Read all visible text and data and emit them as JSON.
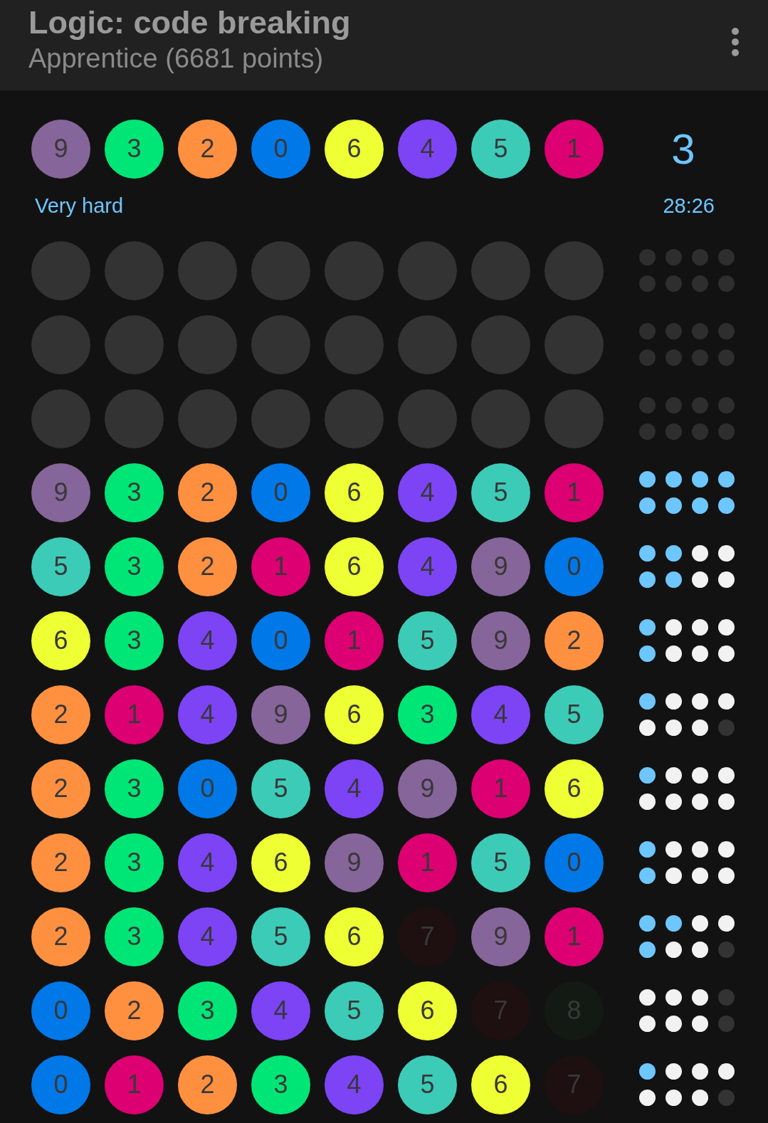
{
  "app_bar": {
    "title": "Logic: code breaking",
    "subtitle": "Apprentice (6681 points)"
  },
  "secret": {
    "pegs": [
      {
        "digit": "9",
        "color": "#86659a"
      },
      {
        "digit": "3",
        "color": "#00e676"
      },
      {
        "digit": "2",
        "color": "#ff9040"
      },
      {
        "digit": "0",
        "color": "#0078e8"
      },
      {
        "digit": "6",
        "color": "#eeff33"
      },
      {
        "digit": "4",
        "color": "#7c44f5"
      },
      {
        "digit": "5",
        "color": "#3ccbb7"
      },
      {
        "digit": "1",
        "color": "#dc0073"
      }
    ],
    "count": "3",
    "difficulty": "Very hard",
    "time": "28:26"
  },
  "rows": [
    {
      "kind": "empty"
    },
    {
      "kind": "empty"
    },
    {
      "kind": "empty"
    },
    {
      "kind": "guess",
      "pegs": [
        {
          "digit": "9",
          "color": "#86659a"
        },
        {
          "digit": "3",
          "color": "#00e676"
        },
        {
          "digit": "2",
          "color": "#ff9040"
        },
        {
          "digit": "0",
          "color": "#0078e8"
        },
        {
          "digit": "6",
          "color": "#eeff33"
        },
        {
          "digit": "4",
          "color": "#7c44f5"
        },
        {
          "digit": "5",
          "color": "#3ccbb7"
        },
        {
          "digit": "1",
          "color": "#dc0073"
        }
      ],
      "feedback": [
        {
          "kind": "hit"
        },
        {
          "kind": "hit"
        },
        {
          "kind": "hit"
        },
        {
          "kind": "hit"
        },
        {
          "kind": "hit"
        },
        {
          "kind": "hit"
        },
        {
          "kind": "hit"
        },
        {
          "kind": "hit"
        }
      ]
    },
    {
      "kind": "guess",
      "pegs": [
        {
          "digit": "5",
          "color": "#3ccbb7"
        },
        {
          "digit": "3",
          "color": "#00e676"
        },
        {
          "digit": "2",
          "color": "#ff9040"
        },
        {
          "digit": "1",
          "color": "#dc0073"
        },
        {
          "digit": "6",
          "color": "#eeff33"
        },
        {
          "digit": "4",
          "color": "#7c44f5"
        },
        {
          "digit": "9",
          "color": "#86659a"
        },
        {
          "digit": "0",
          "color": "#0078e8"
        }
      ],
      "feedback": [
        {
          "kind": "hit"
        },
        {
          "kind": "hit"
        },
        {
          "kind": "near"
        },
        {
          "kind": "near"
        },
        {
          "kind": "hit"
        },
        {
          "kind": "hit"
        },
        {
          "kind": "near"
        },
        {
          "kind": "near"
        }
      ]
    },
    {
      "kind": "guess",
      "pegs": [
        {
          "digit": "6",
          "color": "#eeff33"
        },
        {
          "digit": "3",
          "color": "#00e676"
        },
        {
          "digit": "4",
          "color": "#7c44f5"
        },
        {
          "digit": "0",
          "color": "#0078e8"
        },
        {
          "digit": "1",
          "color": "#dc0073"
        },
        {
          "digit": "5",
          "color": "#3ccbb7"
        },
        {
          "digit": "9",
          "color": "#86659a"
        },
        {
          "digit": "2",
          "color": "#ff9040"
        }
      ],
      "feedback": [
        {
          "kind": "hit"
        },
        {
          "kind": "near"
        },
        {
          "kind": "near"
        },
        {
          "kind": "near"
        },
        {
          "kind": "hit"
        },
        {
          "kind": "near"
        },
        {
          "kind": "near"
        },
        {
          "kind": "near"
        }
      ]
    },
    {
      "kind": "guess",
      "pegs": [
        {
          "digit": "2",
          "color": "#ff9040"
        },
        {
          "digit": "1",
          "color": "#dc0073"
        },
        {
          "digit": "4",
          "color": "#7c44f5"
        },
        {
          "digit": "9",
          "color": "#86659a"
        },
        {
          "digit": "6",
          "color": "#eeff33"
        },
        {
          "digit": "3",
          "color": "#00e676"
        },
        {
          "digit": "4",
          "color": "#7c44f5"
        },
        {
          "digit": "5",
          "color": "#3ccbb7"
        }
      ],
      "feedback": [
        {
          "kind": "hit"
        },
        {
          "kind": "near"
        },
        {
          "kind": "near"
        },
        {
          "kind": "near"
        },
        {
          "kind": "near"
        },
        {
          "kind": "near"
        },
        {
          "kind": "near"
        },
        {
          "kind": "miss"
        }
      ]
    },
    {
      "kind": "guess",
      "pegs": [
        {
          "digit": "2",
          "color": "#ff9040"
        },
        {
          "digit": "3",
          "color": "#00e676"
        },
        {
          "digit": "0",
          "color": "#0078e8"
        },
        {
          "digit": "5",
          "color": "#3ccbb7"
        },
        {
          "digit": "4",
          "color": "#7c44f5"
        },
        {
          "digit": "9",
          "color": "#86659a"
        },
        {
          "digit": "1",
          "color": "#dc0073"
        },
        {
          "digit": "6",
          "color": "#eeff33"
        }
      ],
      "feedback": [
        {
          "kind": "hit"
        },
        {
          "kind": "near"
        },
        {
          "kind": "near"
        },
        {
          "kind": "near"
        },
        {
          "kind": "near"
        },
        {
          "kind": "near"
        },
        {
          "kind": "near"
        },
        {
          "kind": "near"
        }
      ]
    },
    {
      "kind": "guess",
      "pegs": [
        {
          "digit": "2",
          "color": "#ff9040"
        },
        {
          "digit": "3",
          "color": "#00e676"
        },
        {
          "digit": "4",
          "color": "#7c44f5"
        },
        {
          "digit": "6",
          "color": "#eeff33"
        },
        {
          "digit": "9",
          "color": "#86659a"
        },
        {
          "digit": "1",
          "color": "#dc0073"
        },
        {
          "digit": "5",
          "color": "#3ccbb7"
        },
        {
          "digit": "0",
          "color": "#0078e8"
        }
      ],
      "feedback": [
        {
          "kind": "hit"
        },
        {
          "kind": "near"
        },
        {
          "kind": "near"
        },
        {
          "kind": "near"
        },
        {
          "kind": "hit"
        },
        {
          "kind": "near"
        },
        {
          "kind": "near"
        },
        {
          "kind": "near"
        }
      ]
    },
    {
      "kind": "guess",
      "pegs": [
        {
          "digit": "2",
          "color": "#ff9040"
        },
        {
          "digit": "3",
          "color": "#00e676"
        },
        {
          "digit": "4",
          "color": "#7c44f5"
        },
        {
          "digit": "5",
          "color": "#3ccbb7"
        },
        {
          "digit": "6",
          "color": "#eeff33"
        },
        {
          "digit": "7",
          "color": "#1e1010"
        },
        {
          "digit": "9",
          "color": "#86659a"
        },
        {
          "digit": "1",
          "color": "#dc0073"
        }
      ],
      "feedback": [
        {
          "kind": "hit"
        },
        {
          "kind": "hit"
        },
        {
          "kind": "near"
        },
        {
          "kind": "near"
        },
        {
          "kind": "hit"
        },
        {
          "kind": "near"
        },
        {
          "kind": "near"
        },
        {
          "kind": "miss"
        }
      ]
    },
    {
      "kind": "guess",
      "pegs": [
        {
          "digit": "0",
          "color": "#0078e8"
        },
        {
          "digit": "2",
          "color": "#ff9040"
        },
        {
          "digit": "3",
          "color": "#00e676"
        },
        {
          "digit": "4",
          "color": "#7c44f5"
        },
        {
          "digit": "5",
          "color": "#3ccbb7"
        },
        {
          "digit": "6",
          "color": "#eeff33"
        },
        {
          "digit": "7",
          "color": "#1e1010"
        },
        {
          "digit": "8",
          "color": "#131a13"
        }
      ],
      "feedback": [
        {
          "kind": "near"
        },
        {
          "kind": "near"
        },
        {
          "kind": "near"
        },
        {
          "kind": "miss"
        },
        {
          "kind": "near"
        },
        {
          "kind": "near"
        },
        {
          "kind": "near"
        },
        {
          "kind": "miss"
        }
      ]
    },
    {
      "kind": "guess",
      "pegs": [
        {
          "digit": "0",
          "color": "#0078e8"
        },
        {
          "digit": "1",
          "color": "#dc0073"
        },
        {
          "digit": "2",
          "color": "#ff9040"
        },
        {
          "digit": "3",
          "color": "#00e676"
        },
        {
          "digit": "4",
          "color": "#7c44f5"
        },
        {
          "digit": "5",
          "color": "#3ccbb7"
        },
        {
          "digit": "6",
          "color": "#eeff33"
        },
        {
          "digit": "7",
          "color": "#1e1010"
        }
      ],
      "feedback": [
        {
          "kind": "hit"
        },
        {
          "kind": "near"
        },
        {
          "kind": "near"
        },
        {
          "kind": "near"
        },
        {
          "kind": "near"
        },
        {
          "kind": "near"
        },
        {
          "kind": "near"
        },
        {
          "kind": "miss"
        }
      ]
    }
  ]
}
